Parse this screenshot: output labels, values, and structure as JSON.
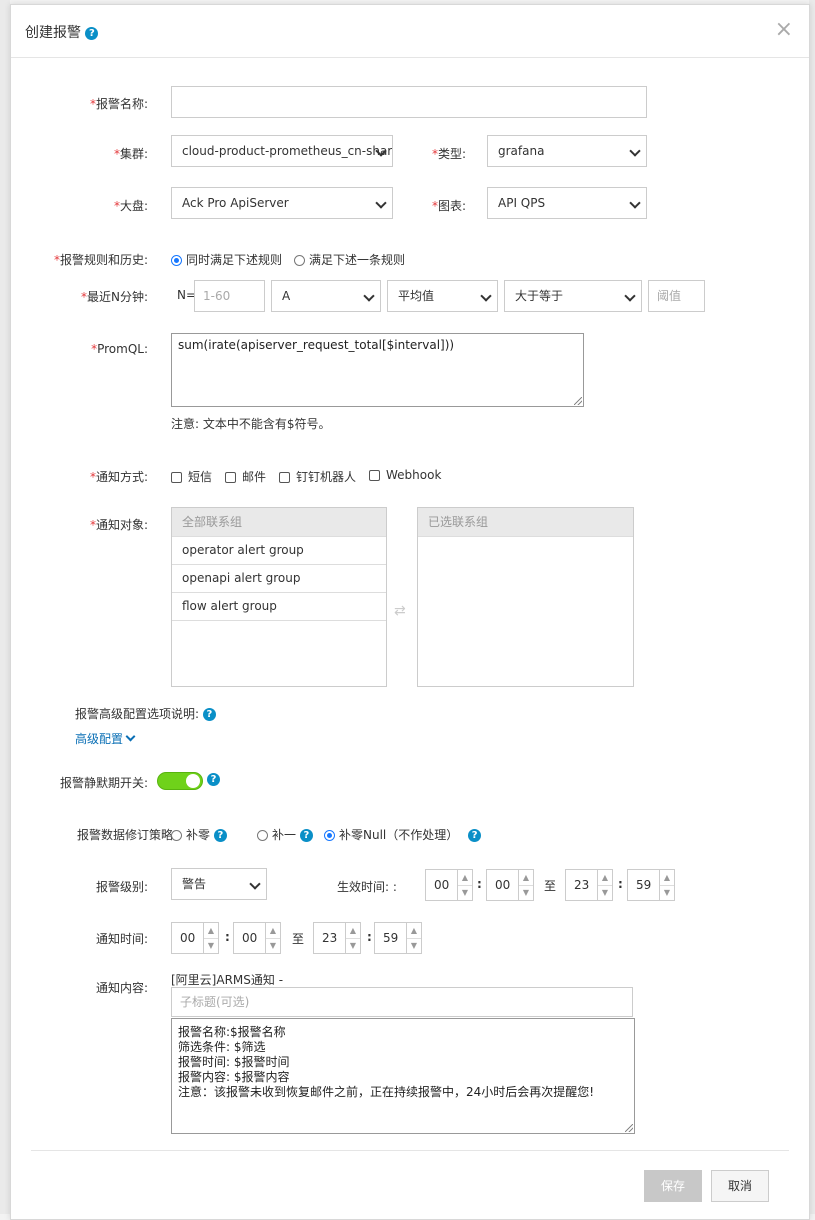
{
  "dialog": {
    "title": "创建报警",
    "close_icon": "×"
  },
  "form": {
    "alert_name": {
      "label": "报警名称:",
      "value": ""
    },
    "cluster": {
      "label": "集群:",
      "value": "cloud-product-prometheus_cn-shar"
    },
    "type": {
      "label": "类型:",
      "value": "grafana"
    },
    "dashboard": {
      "label": "大盘:",
      "value": "Ack Pro ApiServer"
    },
    "chart": {
      "label": "图表:",
      "value": "API QPS"
    },
    "rules": {
      "label": "报警规则和历史:",
      "options": [
        "同时满足下述规则",
        "满足下述一条规则"
      ],
      "selected": 0
    },
    "lastN": {
      "label": "最近N分钟:",
      "n_prefix": "N=",
      "n_placeholder": "1-60",
      "metric": "A",
      "agg": "平均值",
      "op": "大于等于",
      "threshold_placeholder": "阈值"
    },
    "promql": {
      "label": "PromQL:",
      "value": "sum(irate(apiserver_request_total[$interval]))",
      "note": "注意: 文本中不能含有$符号。"
    },
    "notify_method": {
      "label": "通知方式:",
      "options": [
        "短信",
        "邮件",
        "钉钉机器人",
        "Webhook"
      ]
    },
    "notify_target": {
      "label": "通知对象:",
      "all_header": "全部联系组",
      "selected_header": "已选联系组",
      "groups": [
        "operator alert group",
        "openapi alert group",
        "flow alert group"
      ]
    },
    "advanced_note": "报警高级配置选项说明:",
    "advanced_link": "高级配置",
    "silence": {
      "label": "报警静默期开关:",
      "on": true
    },
    "fix_strategy": {
      "label": "报警数据修订策略:",
      "options": [
        "补零",
        "补一",
        "补零Null（不作处理）"
      ],
      "selected": 2
    },
    "level": {
      "label": "报警级别:",
      "value": "警告"
    },
    "effective": {
      "label": "生效时间: :",
      "from_h": "00",
      "from_m": "00",
      "sep": "至",
      "to_h": "23",
      "to_m": "59"
    },
    "notify_time": {
      "label": "通知时间:",
      "from_h": "00",
      "from_m": "00",
      "sep": "至",
      "to_h": "23",
      "to_m": "59"
    },
    "content": {
      "label": "通知内容:",
      "prefix": "[阿里云]ARMS通知 -",
      "subtitle_placeholder": "子标题(可选)",
      "body": "报警名称:$报警名称\n筛选条件: $筛选\n报警时间: $报警时间\n报警内容: $报警内容\n注意：该报警未收到恢复邮件之前，正在持续报警中，24小时后会再次提醒您!"
    }
  },
  "footer": {
    "save_label": "保存",
    "cancel_label": "取消"
  },
  "colors": {
    "accent": "#0a8fc7",
    "toggle_on": "#6fd21a",
    "required": "#e4393c"
  }
}
